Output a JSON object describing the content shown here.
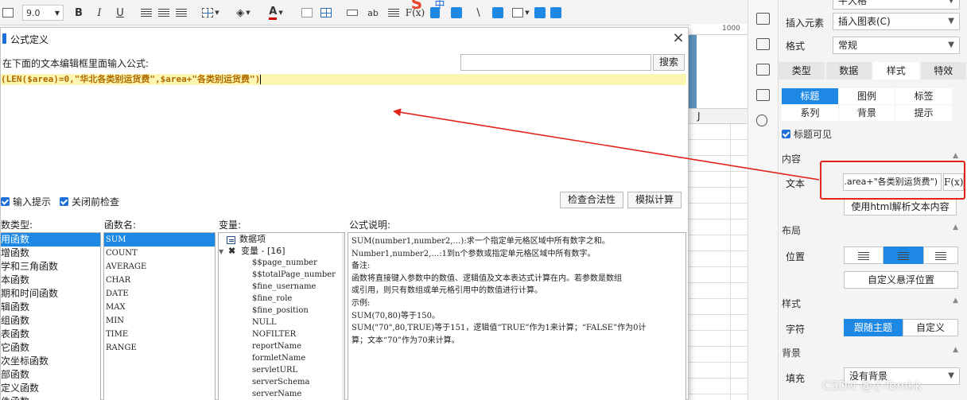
{
  "toolbar": {
    "font_size": "9.0",
    "bold": "B",
    "italic": "I",
    "underline": "U",
    "text_color": "A",
    "font_color_hex": "#cc0000",
    "ab_label": "ab",
    "fx_label": "F(x)"
  },
  "sheet": {
    "ruler_value": "1000",
    "col_j": "J"
  },
  "dialog": {
    "title": "公式定义",
    "close": "×",
    "instruction": "在下面的文本编辑框里面输入公式:",
    "search_placeholder": "",
    "search_button": "搜索",
    "formula": "(LEN($area)=0,\"华北各类别运货费\",$area+\"各类别运货费\")",
    "hint_checkbox": "输入提示",
    "precheck_checkbox": "关闭前检查",
    "check_button": "检查合法性",
    "simulate_button": "模拟计算",
    "labels": {
      "category": "数类型:",
      "fn_name": "函数名:",
      "variable": "变量:",
      "description": "公式说明:"
    },
    "categories": [
      "用函数",
      "增函数",
      "学和三角函数",
      "本函数",
      "期和时间函数",
      "辑函数",
      "组函数",
      "表函数",
      "它函数",
      "次坐标函数",
      "部函数",
      "定义函数",
      "件函数"
    ],
    "selected_category": 0,
    "functions": [
      "SUM",
      "COUNT",
      "AVERAGE",
      "CHAR",
      "DATE",
      "MAX",
      "MIN",
      "TIME",
      "RANGE"
    ],
    "selected_function": 0,
    "variables_root": "数据项",
    "variables_group": "变量 - [16]",
    "variables": [
      "$$page_number",
      "$$totalPage_number",
      "$fine_username",
      "$fine_role",
      "$fine_position",
      "NULL",
      "NOFILTER",
      "reportName",
      "formletName",
      "servletURL",
      "serverSchema",
      "serverName"
    ],
    "description_lines": [
      "SUM(number1,number2,…):求一个指定单元格区域中所有数字之和。",
      "Number1,number2,…:1到n个参数或指定单元格区域中所有数字。",
      "备注:",
      "函数将直接键入参数中的数值、逻辑值及文本表达式计算在内。若参数是数组",
      "或引用，则只有数组或单元格引用中的数值进行计算。",
      "示例:",
      "SUM(70,80)等于150。",
      "SUM(\"70\",80,TRUE)等于151，逻辑值“TRUE”作为1来计算；“FALSE”作为0计",
      "算；文本“70”作为70来计算。"
    ]
  },
  "right_panel": {
    "top_partial": "平大格",
    "insert_element_label": "插入元素",
    "insert_element_value": "插入图表(C)",
    "format_label": "格式",
    "format_value": "常规",
    "tabs": [
      "类型",
      "数据",
      "样式",
      "特效"
    ],
    "active_tab": 2,
    "sub_tabs": [
      "标题",
      "图例",
      "标签",
      "系列",
      "背景",
      "提示"
    ],
    "active_sub_tab": 0,
    "title_visible": "标题可见",
    "content_section": "内容",
    "text_label": "文本",
    "text_value": ".area+\"各类别运货费\")",
    "fx_button": "F(x)",
    "html_button": "使用html解析文本内容",
    "layout_section": "布局",
    "position_label": "位置",
    "custom_float_button": "自定义悬浮位置",
    "style_section": "样式",
    "font_label": "字符",
    "follow_theme_button": "跟随主题",
    "custom_button": "自定义",
    "background_section": "背景",
    "fill_label": "填充",
    "fill_value": "没有背景",
    "accent_color": "#1e88e5",
    "highlight_color": "#e2231a"
  },
  "watermark": "CSDN @小Tomkk"
}
